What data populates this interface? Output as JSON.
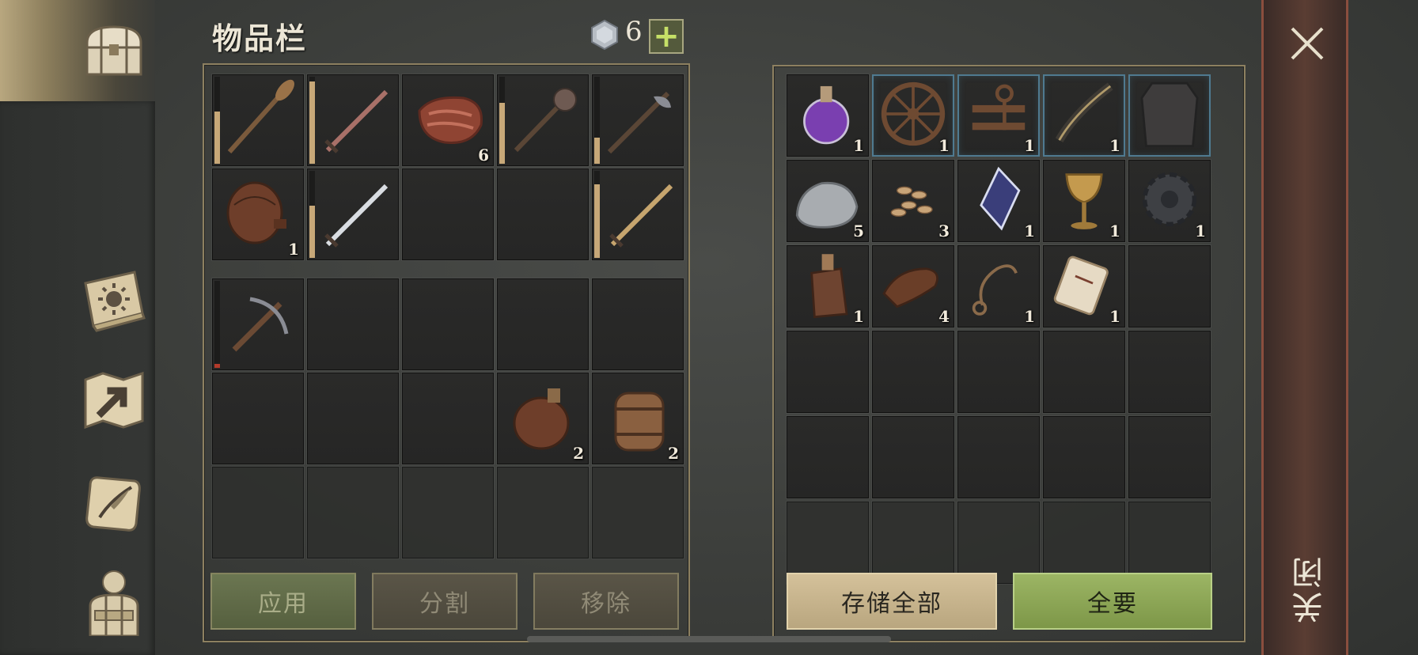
{
  "inventory": {
    "title": "物品栏",
    "currency_count": "6",
    "plus_label": "+"
  },
  "left_grid_top": [
    {
      "item": "oar",
      "durability": 0.6,
      "count": ""
    },
    {
      "item": "sword",
      "durability": 0.95,
      "count": ""
    },
    {
      "item": "meat",
      "durability": null,
      "count": "6"
    },
    {
      "item": "mace",
      "durability": 0.7,
      "count": ""
    },
    {
      "item": "halberd",
      "durability": 0.3,
      "count": ""
    },
    {
      "item": "waterskin",
      "durability": null,
      "count": "1"
    },
    {
      "item": "steel-sword",
      "durability": 0.6,
      "count": ""
    },
    {
      "item": "",
      "durability": null,
      "count": ""
    },
    {
      "item": "",
      "durability": null,
      "count": ""
    },
    {
      "item": "gold-sword",
      "durability": 0.85,
      "count": ""
    }
  ],
  "left_grid_bottom": [
    {
      "item": "crossbow",
      "durability": 0.05,
      "durability_color": "red",
      "count": ""
    },
    {
      "item": "",
      "count": ""
    },
    {
      "item": "",
      "count": ""
    },
    {
      "item": "",
      "count": ""
    },
    {
      "item": "",
      "count": ""
    },
    {
      "item": "",
      "count": ""
    },
    {
      "item": "",
      "count": ""
    },
    {
      "item": "",
      "count": ""
    },
    {
      "item": "flask",
      "count": "2"
    },
    {
      "item": "barrel",
      "count": "2"
    }
  ],
  "right_grid": [
    {
      "item": "potion",
      "count": "1",
      "blue": false
    },
    {
      "item": "wheel",
      "count": "1",
      "blue": true
    },
    {
      "item": "ballista-part",
      "count": "1",
      "blue": true
    },
    {
      "item": "bow-limb",
      "count": "1",
      "blue": true
    },
    {
      "item": "chainmail",
      "count": "",
      "blue": true
    },
    {
      "item": "stone",
      "count": "5",
      "blue": false
    },
    {
      "item": "seeds",
      "count": "3",
      "blue": false
    },
    {
      "item": "crystal",
      "count": "1",
      "blue": false
    },
    {
      "item": "goblet",
      "count": "1",
      "blue": false
    },
    {
      "item": "gear",
      "count": "1",
      "blue": false
    },
    {
      "item": "bottle",
      "count": "1",
      "blue": false
    },
    {
      "item": "leather",
      "count": "4",
      "blue": false
    },
    {
      "item": "rope",
      "count": "1",
      "blue": false
    },
    {
      "item": "scroll",
      "count": "1",
      "blue": false
    }
  ],
  "buttons": {
    "apply": "应用",
    "split": "分割",
    "remove": "移除",
    "store_all": "存储全部",
    "take_all": "全要"
  },
  "close": {
    "label": "关闭"
  },
  "sidebar": [
    "chest-icon",
    "sun-book-icon",
    "map-icon",
    "quill-scroll-icon",
    "character-icon"
  ]
}
